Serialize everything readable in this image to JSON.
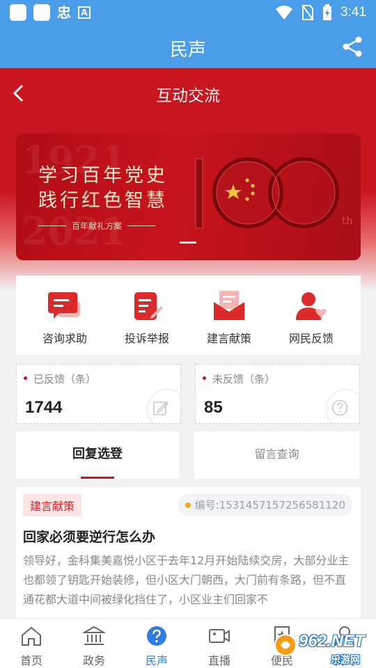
{
  "status_bar": {
    "app_glyph": "忠",
    "badge_glyph": "A",
    "time": "3:41"
  },
  "app_bar": {
    "title": "民声",
    "share_icon": "share-icon"
  },
  "header": {
    "title": "互动交流",
    "back_icon": "back-arrow-icon"
  },
  "banner": {
    "line1": "学习百年党史",
    "line2": "践行红色智慧",
    "subtitle": "百年献礼方案",
    "year_top": "1921",
    "year_bottom": "2021",
    "suffix": "th"
  },
  "actions": [
    {
      "label": "咨询求助",
      "icon": "chat-bubble-icon"
    },
    {
      "label": "投诉举报",
      "icon": "report-document-icon"
    },
    {
      "label": "建言献策",
      "icon": "envelope-icon"
    },
    {
      "label": "网民反馈",
      "icon": "user-heart-icon"
    }
  ],
  "stats": [
    {
      "label": "已反馈（条）",
      "value": "1744",
      "icon": "edit-icon"
    },
    {
      "label": "未反馈（条）",
      "value": "85",
      "icon": "question-icon"
    }
  ],
  "tabs": [
    {
      "label": "回复选登",
      "active": true
    },
    {
      "label": "留言查询",
      "active": false
    }
  ],
  "message": {
    "tag": "建言献策",
    "id": "编号:1531457157256581120",
    "title": "回家必须要逆行怎么办",
    "body": "领导好，金科集美嘉悦小区于去年12月开始陆续交房，大部分业主也都领了钥匙开始装修，但小区大门朝西，大门前有条路，但不直通花都大道中间被绿化挡住了，小区业主们回家不"
  },
  "bottom_nav": [
    {
      "label": "首页",
      "icon": "home-icon"
    },
    {
      "label": "政务",
      "icon": "government-building-icon"
    },
    {
      "label": "民声",
      "icon": "question-circle-icon",
      "active": true
    },
    {
      "label": "直播",
      "icon": "video-camera-icon"
    },
    {
      "label": "便民",
      "icon": "star-badge-icon"
    },
    {
      "label": "我的",
      "icon": "person-icon"
    }
  ],
  "watermark": {
    "brand": "962.NET",
    "text": "乐游网"
  },
  "colors": {
    "app_blue": "#4a9de8",
    "party_red": "#c9151e",
    "active_blue": "#2f7de0"
  }
}
